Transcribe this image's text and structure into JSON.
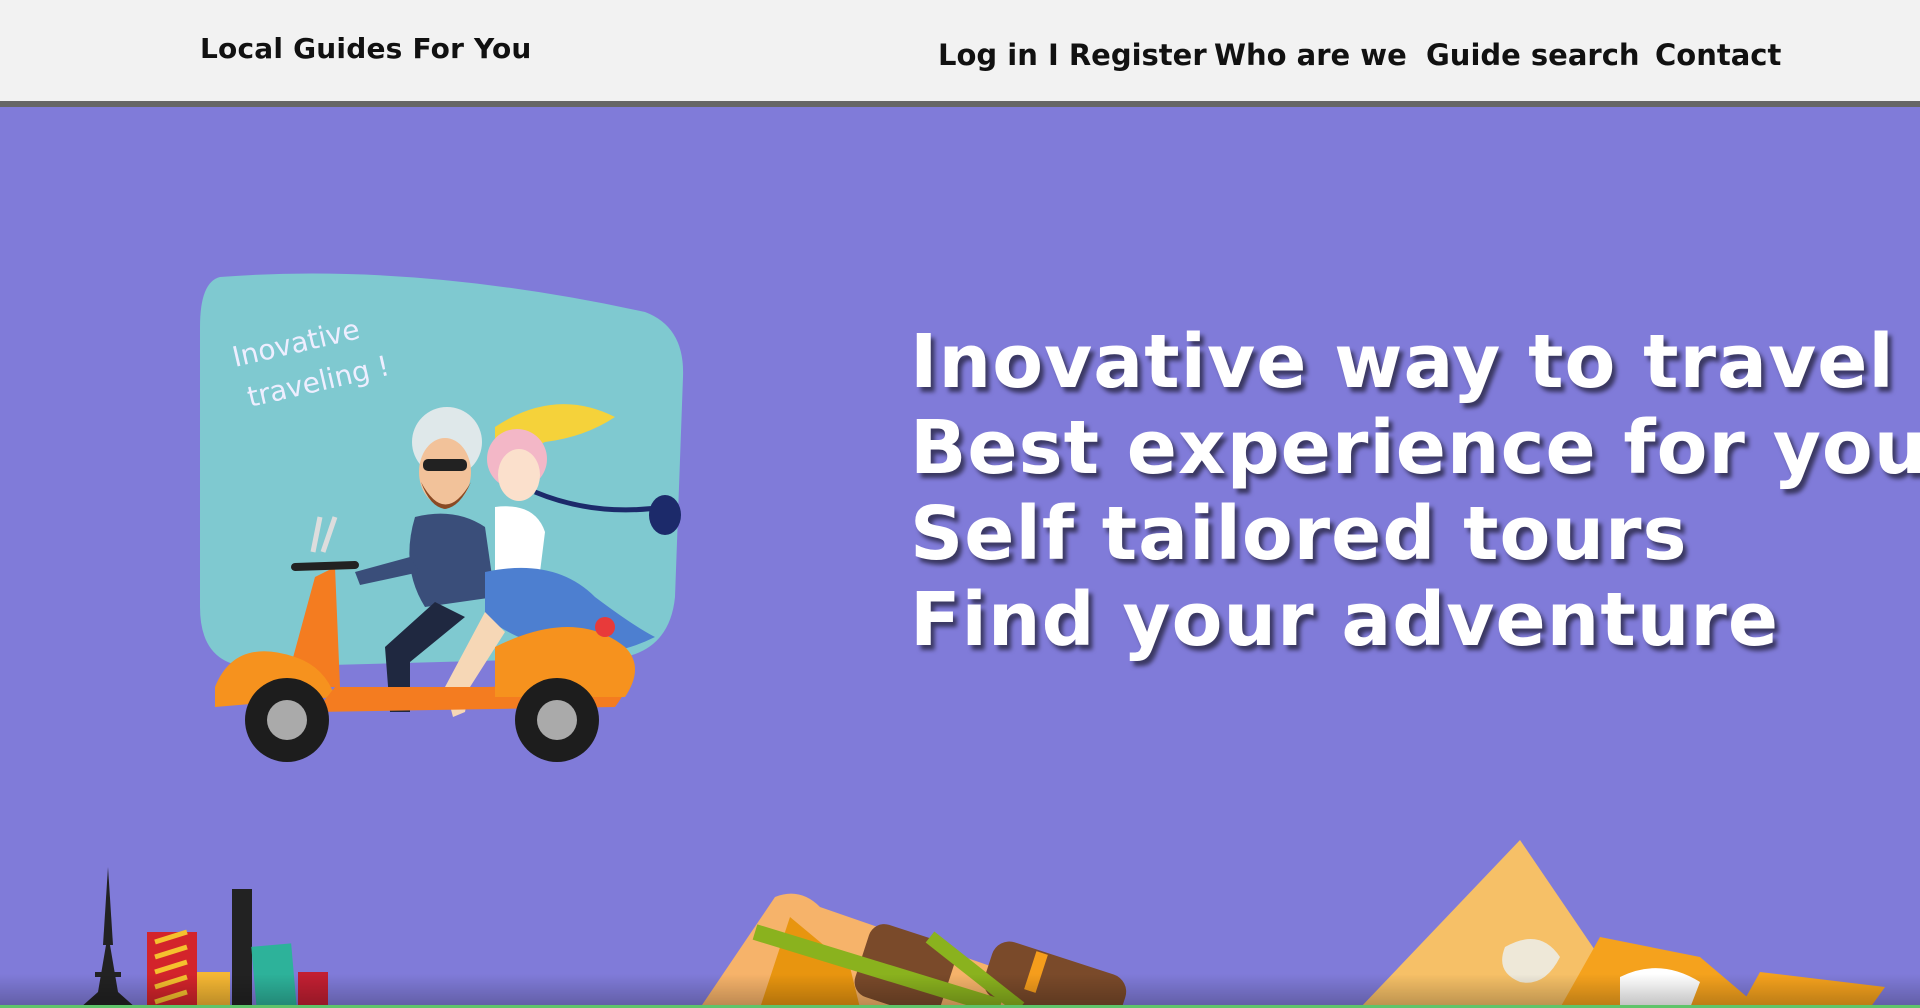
{
  "header": {
    "brand": "Local Guides For You",
    "nav": {
      "login": "Log in I Register",
      "who": "Who are we",
      "search": "Guide search",
      "contact": "Contact"
    }
  },
  "hero": {
    "illustration_caption": [
      "Inovative",
      "traveling !"
    ],
    "taglines": [
      "Inovative way to travel",
      "Best experience for you",
      "Self tailored tours",
      "Find your adventure"
    ]
  },
  "colors": {
    "header_bg": "#f2f2f2",
    "hero_bg": "#807bd9",
    "bubble": "#7fc9d0",
    "scooter": "#f47c20"
  }
}
